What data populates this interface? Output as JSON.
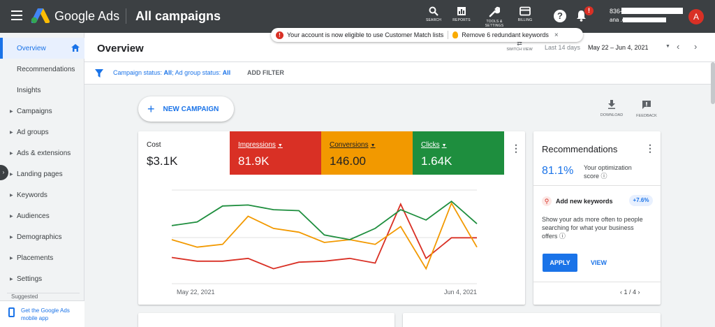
{
  "header": {
    "brand": "Google Ads",
    "title": "All campaigns",
    "tools": [
      {
        "label": "SEARCH",
        "icon": "search-icon"
      },
      {
        "label": "REPORTS",
        "icon": "reports-icon"
      },
      {
        "label": "TOOLS & SETTINGS",
        "icon": "wrench-icon"
      },
      {
        "label": "BILLING",
        "icon": "billing-icon"
      }
    ],
    "help": "?",
    "notification_count": "!",
    "account_id": "836-",
    "account_email": "ana .com",
    "avatar_letter": "A"
  },
  "notification": {
    "message1": "Your account is now eligible to use Customer Match lists",
    "message2": "Remove 6 redundant keywords",
    "close": "×"
  },
  "sidebar": {
    "items": [
      {
        "label": "Overview",
        "active": true,
        "arrow": false
      },
      {
        "label": "Recommendations",
        "arrow": false
      },
      {
        "label": "Insights",
        "arrow": false
      },
      {
        "label": "Campaigns",
        "arrow": true
      },
      {
        "label": "Ad groups",
        "arrow": true
      },
      {
        "label": "Ads & extensions",
        "arrow": true
      },
      {
        "label": "Landing pages",
        "arrow": true
      },
      {
        "label": "Keywords",
        "arrow": true
      },
      {
        "label": "Audiences",
        "arrow": true
      },
      {
        "label": "Demographics",
        "arrow": true
      },
      {
        "label": "Placements",
        "arrow": true
      },
      {
        "label": "Settings",
        "arrow": true
      }
    ],
    "suggested": "Suggested",
    "mobile_app": "Get the Google Ads mobile app"
  },
  "overview": {
    "title": "Overview",
    "switch_view": "SWITCH VIEW",
    "last_days": "Last 14 days",
    "date_range": "May 22 – Jun 4, 2021"
  },
  "filter": {
    "campaign_status_label": "Campaign status: ",
    "campaign_status_value": "All",
    "adgroup_status_label": "; Ad group status: ",
    "adgroup_status_value": "All",
    "add_filter": "ADD FILTER"
  },
  "actions": {
    "new_campaign": "NEW CAMPAIGN",
    "download": "DOWNLOAD",
    "feedback": "FEEDBACK"
  },
  "metrics": [
    {
      "name": "Cost",
      "value": "$3.1K",
      "color": "#ffffff"
    },
    {
      "name": "Impressions",
      "value": "81.9K",
      "color": "#d93025"
    },
    {
      "name": "Conversions",
      "value": "146.00",
      "color": "#f29900"
    },
    {
      "name": "Clicks",
      "value": "1.64K",
      "color": "#1e8e3e"
    }
  ],
  "chart_data": {
    "type": "line",
    "x_start_label": "May 22, 2021",
    "x_end_label": "Jun 4, 2021",
    "grid": true,
    "series": [
      {
        "name": "Impressions",
        "color": "#d93025",
        "values": [
          0.28,
          0.24,
          0.24,
          0.27,
          0.16,
          0.23,
          0.24,
          0.27,
          0.22,
          0.85,
          0.27,
          0.49,
          0.49
        ]
      },
      {
        "name": "Conversions",
        "color": "#f29900",
        "values": [
          0.47,
          0.39,
          0.42,
          0.72,
          0.59,
          0.55,
          0.44,
          0.47,
          0.42,
          0.61,
          0.16,
          0.86,
          0.39
        ]
      },
      {
        "name": "Clicks",
        "color": "#1e8e3e",
        "values": [
          0.62,
          0.66,
          0.83,
          0.84,
          0.79,
          0.78,
          0.52,
          0.47,
          0.59,
          0.79,
          0.68,
          0.88,
          0.64
        ]
      }
    ]
  },
  "recommendations": {
    "title": "Recommendations",
    "score": "81.1%",
    "score_label": "Your optimization score",
    "item_title": "Add new keywords",
    "item_badge": "+7.6%",
    "item_desc": "Show your ads more often to people searching for what your business offers",
    "apply": "APPLY",
    "view": "VIEW",
    "pager": "1 / 4"
  }
}
